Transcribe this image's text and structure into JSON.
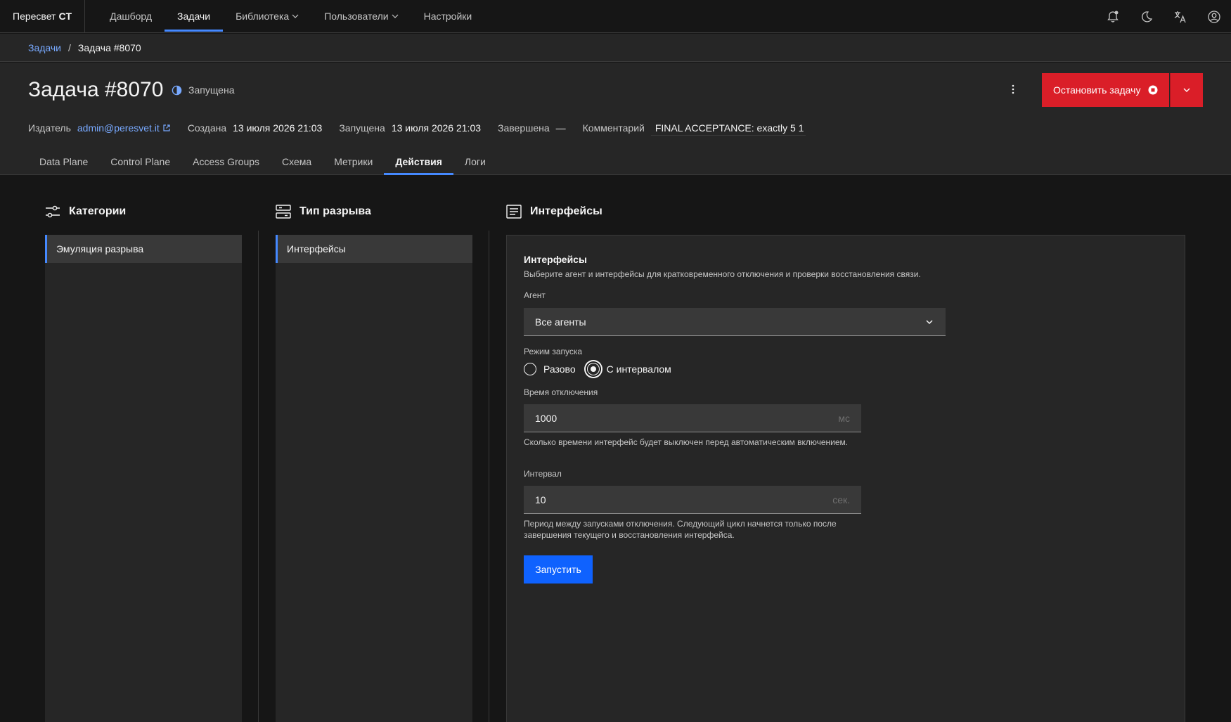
{
  "nav": {
    "brand_prefix": "Пересвет",
    "brand_suffix": "CT",
    "items": [
      {
        "label": "Дашборд"
      },
      {
        "label": "Задачи"
      },
      {
        "label": "Библиотека"
      },
      {
        "label": "Пользователи"
      },
      {
        "label": "Настройки"
      }
    ],
    "active_index": 1,
    "action_icons": [
      "notification-icon",
      "moon-icon",
      "translate-icon",
      "user-avatar-icon"
    ]
  },
  "breadcrumb": {
    "link": "Задачи",
    "separator": "/",
    "current": "Задача #8070"
  },
  "header": {
    "title": "Задача #8070",
    "status": "Запущена",
    "stop_button": "Остановить задачу",
    "meta": {
      "publisher_label": "Издатель",
      "publisher": "admin@peresvet.it",
      "created_label": "Создана",
      "created": "13 июля 2026 21:03",
      "started_label": "Запущена",
      "started": "13 июля 2026 21:03",
      "finished_label": "Завершена",
      "finished": "—",
      "comment_label": "Комментарий",
      "comment": "FINAL ACCEPTANCE: exactly 5 1"
    }
  },
  "tabs": [
    {
      "label": "Data Plane"
    },
    {
      "label": "Control Plane"
    },
    {
      "label": "Access Groups"
    },
    {
      "label": "Схема"
    },
    {
      "label": "Метрики"
    },
    {
      "label": "Действия"
    },
    {
      "label": "Логи"
    }
  ],
  "active_tab": 5,
  "columns": {
    "categories": {
      "title": "Категории",
      "items": [
        "Эмуляция разрыва"
      ]
    },
    "break_type": {
      "title": "Тип разрыва",
      "items": [
        "Интерфейсы"
      ]
    },
    "interfaces": {
      "title": "Интерфейсы"
    }
  },
  "form": {
    "title": "Интерфейсы",
    "description": "Выберите агент и интерфейсы для кратковременного отключения и проверки восстановления связи.",
    "agent_label": "Агент",
    "agent_value": "Все агенты",
    "mode_label": "Режим запуска",
    "mode_options": [
      "Разово",
      "С интервалом"
    ],
    "mode_selected": 1,
    "downtime_label": "Время отключения",
    "downtime_value": "1000",
    "downtime_unit": "мс",
    "downtime_help": "Сколько времени интерфейс будет выключен перед автоматическим включением.",
    "interval_label": "Интервал",
    "interval_value": "10",
    "interval_unit": "сек.",
    "interval_help": "Период между запусками отключения. Следующий цикл начнется только после завершения текущего и восстановления интерфейса.",
    "run_button": "Запустить"
  },
  "colors": {
    "accent": "#4589ff",
    "danger": "#da1e28",
    "primary": "#0f62fe",
    "link": "#78a9ff"
  }
}
